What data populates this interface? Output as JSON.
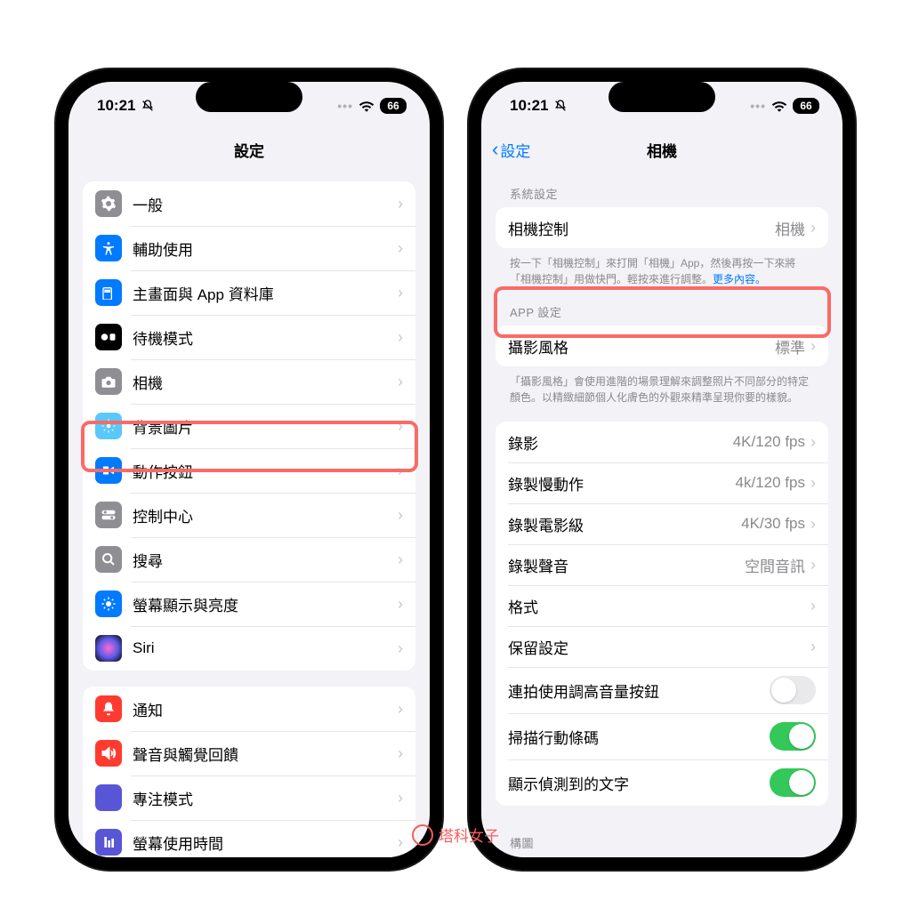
{
  "status": {
    "time": "10:21",
    "silent_icon": "bell-slash-icon",
    "wifi_icon": "wifi-icon",
    "battery_level": "66"
  },
  "left": {
    "title": "設定",
    "items": [
      {
        "icon": "gear-icon",
        "bg": "bg-gray",
        "label": "一般"
      },
      {
        "icon": "accessibility-icon",
        "bg": "bg-blue",
        "label": "輔助使用"
      },
      {
        "icon": "apps-icon",
        "bg": "bg-blue",
        "label": "主畫面與 App 資料庫"
      },
      {
        "icon": "standby-icon",
        "bg": "bg-black",
        "label": "待機模式"
      },
      {
        "icon": "camera-icon",
        "bg": "bg-gray",
        "label": "相機",
        "highlighted": true
      },
      {
        "icon": "wallpaper-icon",
        "bg": "bg-lblue",
        "label": "背景圖片"
      },
      {
        "icon": "action-button-icon",
        "bg": "bg-blue",
        "label": "動作按鈕"
      },
      {
        "icon": "control-center-icon",
        "bg": "bg-gray",
        "label": "控制中心"
      },
      {
        "icon": "search-icon",
        "bg": "bg-gray",
        "label": "搜尋"
      },
      {
        "icon": "display-icon",
        "bg": "bg-blue",
        "label": "螢幕顯示與亮度"
      },
      {
        "icon": "siri-icon",
        "bg": "siri-icon",
        "label": "Siri"
      }
    ],
    "group2": [
      {
        "icon": "notifications-icon",
        "bg": "bg-red",
        "label": "通知"
      },
      {
        "icon": "sounds-icon",
        "bg": "bg-red",
        "label": "聲音與觸覺回饋"
      },
      {
        "icon": "focus-icon",
        "bg": "bg-purple",
        "label": "專注模式"
      },
      {
        "icon": "screentime-icon",
        "bg": "bg-purple",
        "label": "螢幕使用時間"
      }
    ]
  },
  "right": {
    "back_label": "設定",
    "title": "相機",
    "section1_header": "系統設定",
    "camera_control": {
      "label": "相機控制",
      "value": "相機",
      "highlighted": true
    },
    "footer1_a": "按一下「相機控制」來打開「相機」App，然後再按一下來將「相機控制」用做快門。輕按來進行調整。",
    "footer1_link": "更多內容。",
    "section2_header": "APP 設定",
    "photo_style": {
      "label": "攝影風格",
      "value": "標準"
    },
    "footer2": "「攝影風格」會使用進階的場景理解來調整照片不同部分的特定顏色。以精緻細節個人化膚色的外觀來精準呈現你要的樣貌。",
    "rows": [
      {
        "label": "錄影",
        "value": "4K/120 fps"
      },
      {
        "label": "錄製慢動作",
        "value": "4k/120 fps"
      },
      {
        "label": "錄製電影級",
        "value": "4K/30 fps"
      },
      {
        "label": "錄製聲音",
        "value": "空間音訊"
      },
      {
        "label": "格式",
        "value": ""
      },
      {
        "label": "保留設定",
        "value": ""
      }
    ],
    "toggles": [
      {
        "label": "連拍使用調高音量按鈕",
        "on": false
      },
      {
        "label": "掃描行動條碼",
        "on": true
      },
      {
        "label": "顯示偵測到的文字",
        "on": true
      }
    ],
    "bottom_partial": "構圖"
  },
  "watermark": "塔科女子"
}
